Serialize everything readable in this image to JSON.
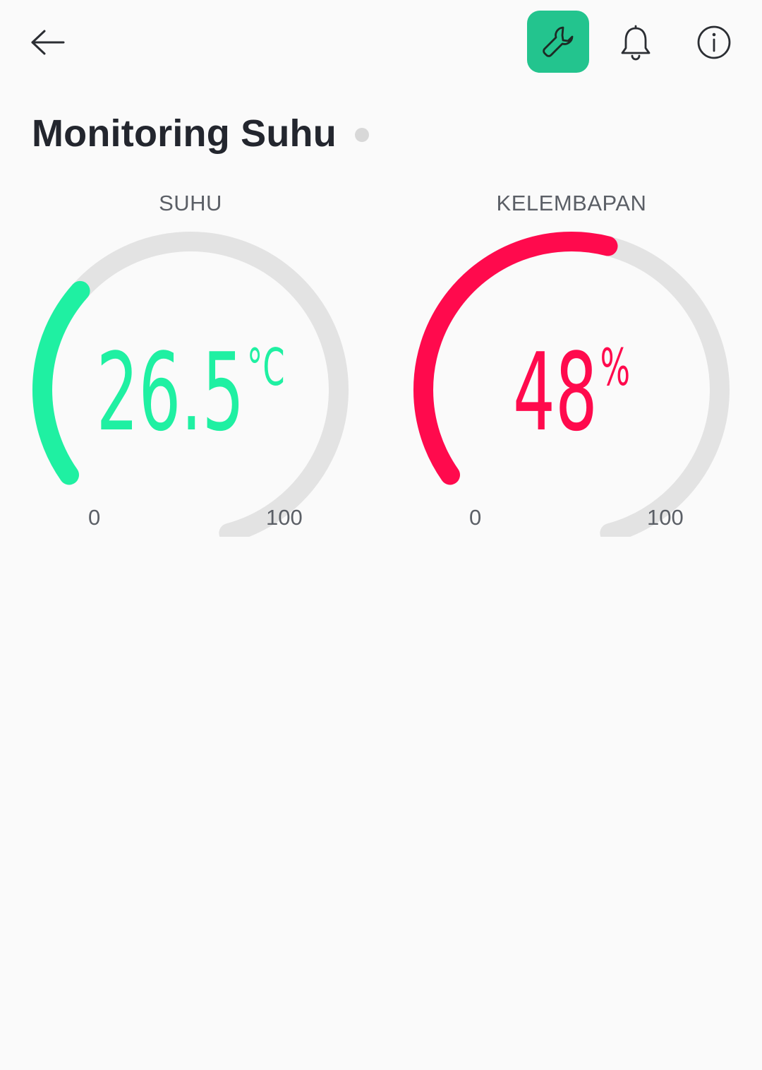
{
  "header": {
    "back_icon": "arrow-left-icon",
    "settings_icon": "wrench-icon",
    "notifications_icon": "bell-icon",
    "info_icon": "info-circle-icon",
    "accent_color": "#23c48e"
  },
  "page": {
    "title": "Monitoring Suhu",
    "status_dot_color": "#d8d8d8"
  },
  "gauges": [
    {
      "label": "SUHU",
      "value": "26.5",
      "unit": "°C",
      "numeric_value": 26.5,
      "min": "0",
      "max": "100",
      "color": "#1ff0a2",
      "track_color": "#e3e3e3"
    },
    {
      "label": "KELEMBAPAN",
      "value": "48",
      "unit": "%",
      "numeric_value": 48,
      "min": "0",
      "max": "100",
      "color": "#ff0a4d",
      "track_color": "#e3e3e3"
    }
  ]
}
